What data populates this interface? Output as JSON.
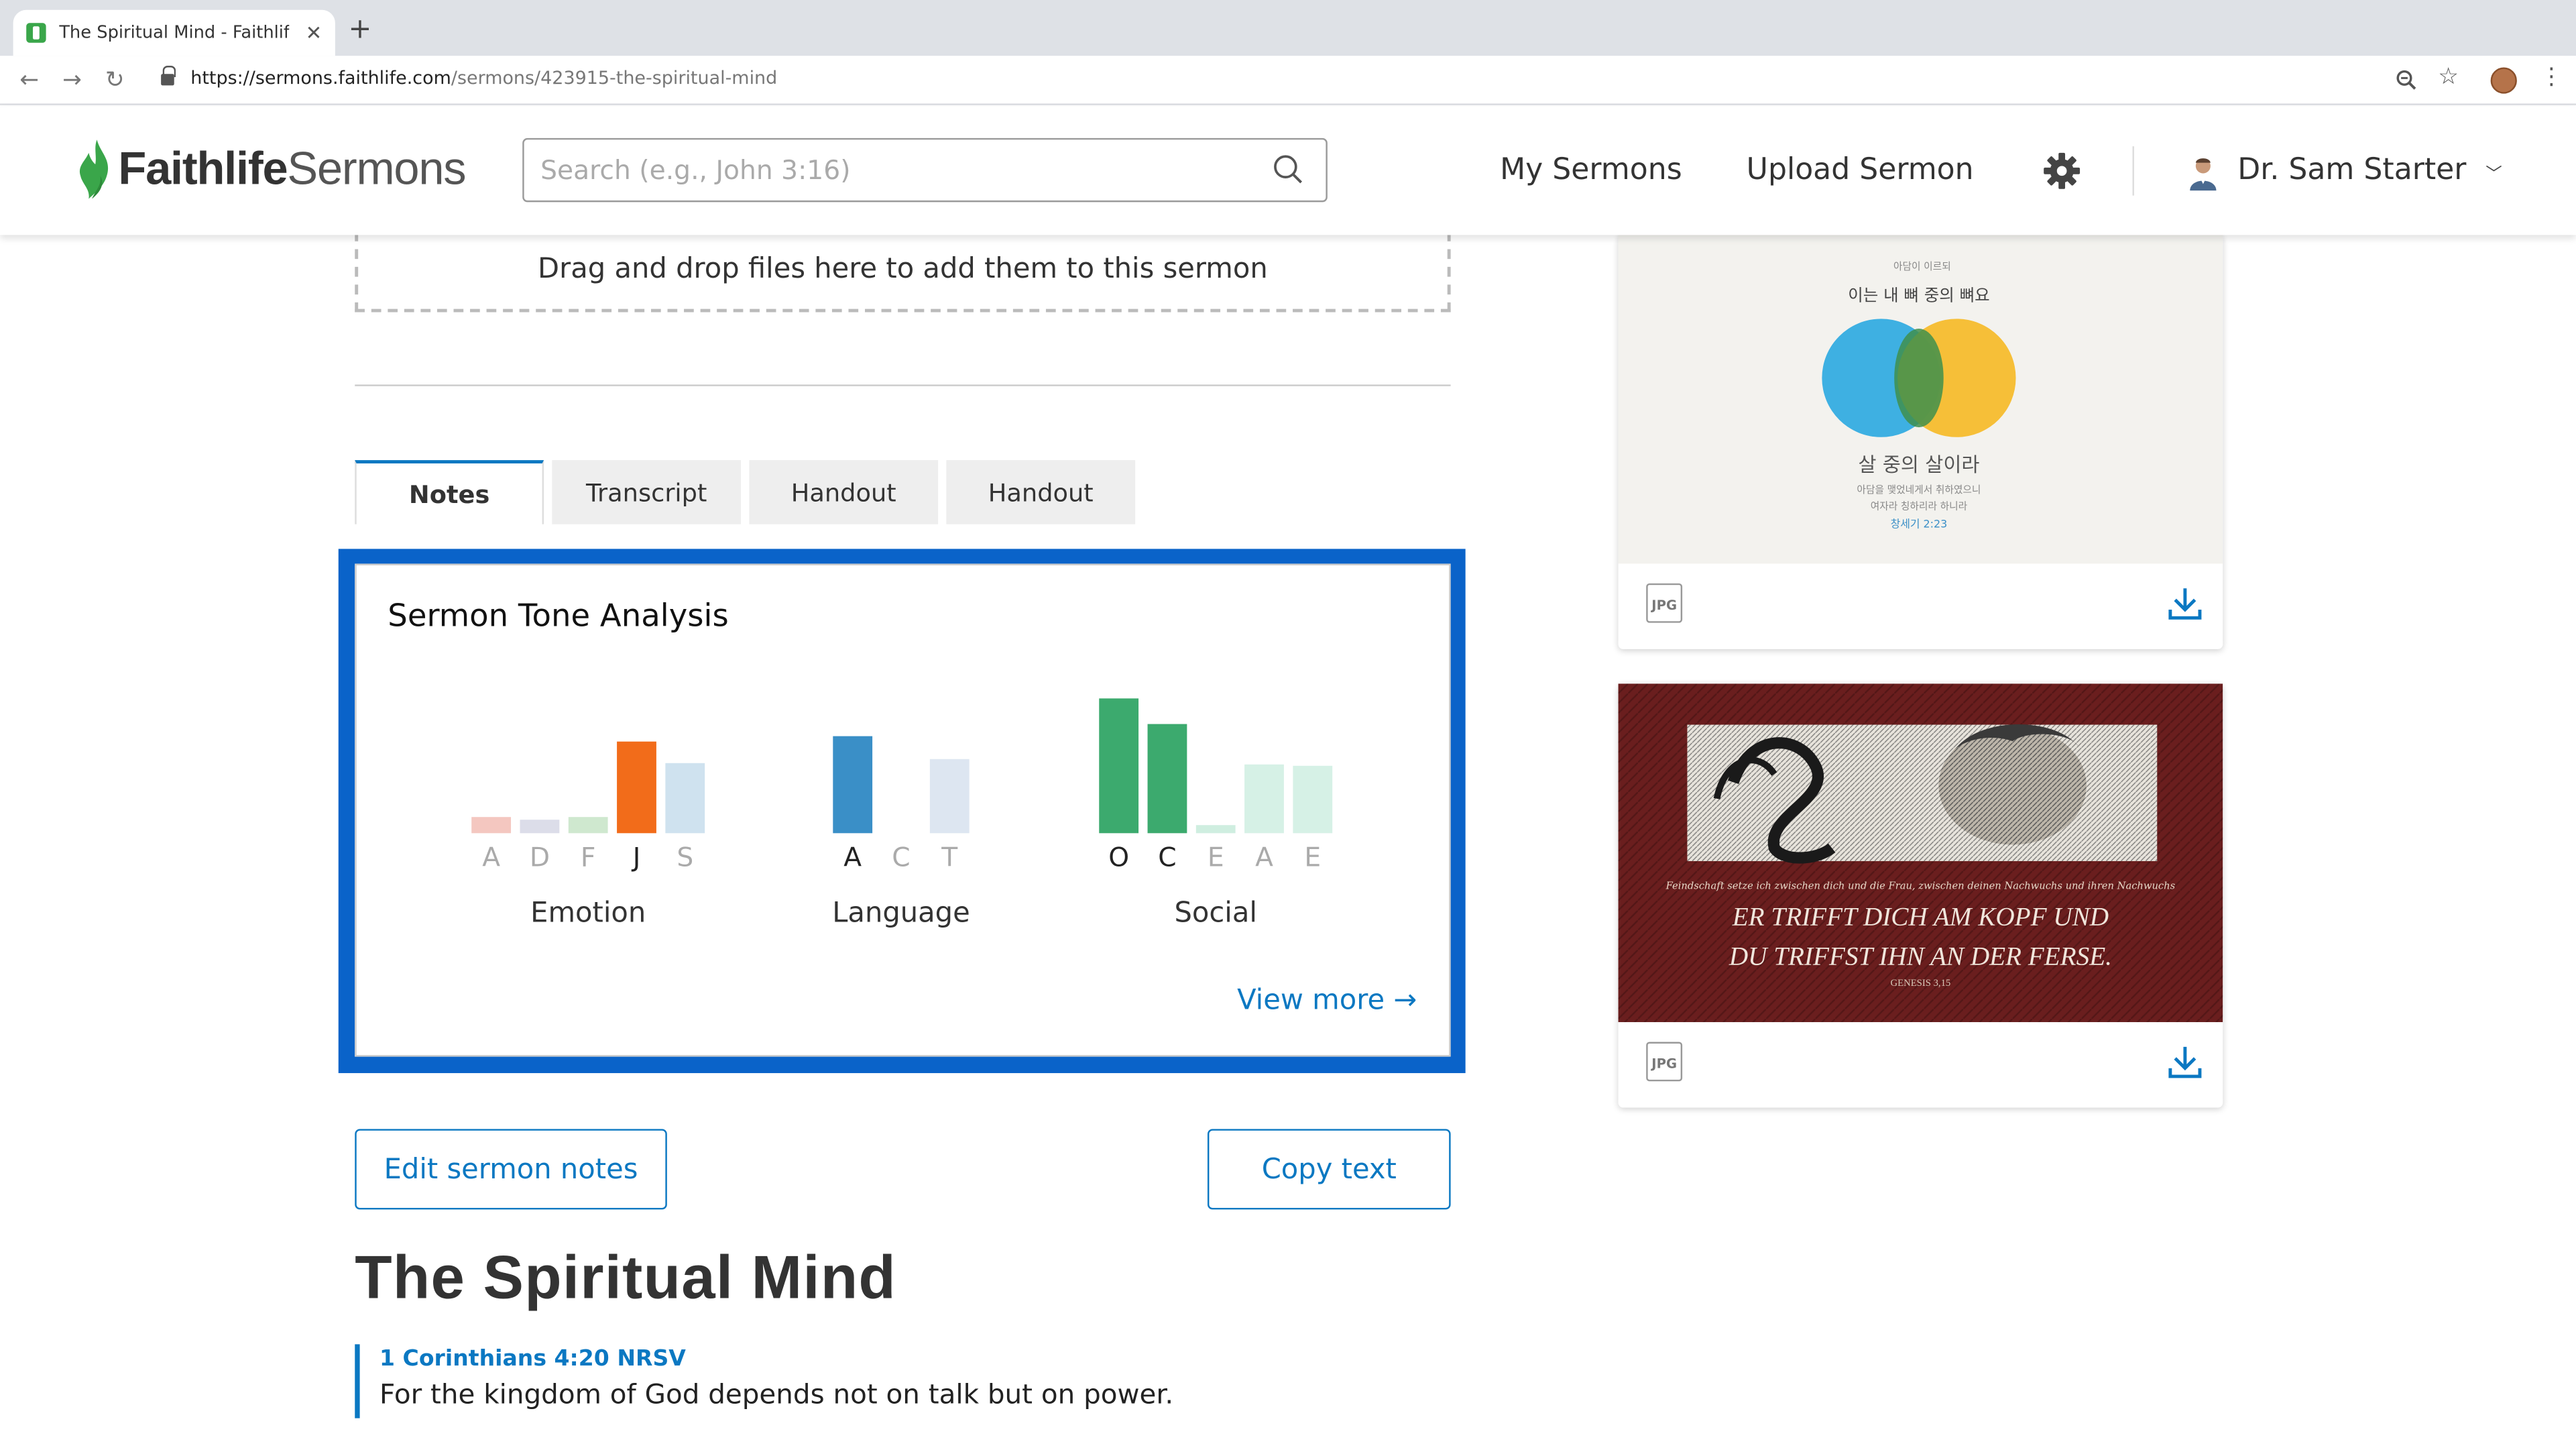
{
  "browser": {
    "tab_title": "The Spiritual Mind - Faithlife Sermons",
    "url_domain": "https://sermons.faithlife.com",
    "url_path": "/sermons/423915-the-spiritual-mind"
  },
  "header": {
    "logo_bold": "Faithlife",
    "logo_light": "Sermons",
    "search_placeholder": "Search (e.g., John 3:16)",
    "nav": [
      "My Sermons",
      "Upload Sermon"
    ],
    "user_name": "Dr. Sam Starter"
  },
  "dropzone_text": "Drag and drop files here to add them to this sermon",
  "tabs": [
    {
      "label": "Notes",
      "active": true
    },
    {
      "label": "Transcript",
      "active": false
    },
    {
      "label": "Handout",
      "active": false
    },
    {
      "label": "Handout",
      "active": false
    }
  ],
  "tone": {
    "title": "Sermon Tone Analysis",
    "view_more": "View more →"
  },
  "chart_data": {
    "type": "bar",
    "groups": [
      {
        "name": "Emotion",
        "categories": [
          "A",
          "D",
          "F",
          "J",
          "S"
        ],
        "values": [
          0.12,
          0.1,
          0.12,
          0.68,
          0.52
        ],
        "colors": [
          "#f4c7c0",
          "#dcdde9",
          "#cfe8cf",
          "#f26c1a",
          "#cfe2ef"
        ],
        "highlight": [
          false,
          false,
          false,
          true,
          false
        ]
      },
      {
        "name": "Language",
        "categories": [
          "A",
          "C",
          "T"
        ],
        "values": [
          0.72,
          0.0,
          0.55
        ],
        "colors": [
          "#3a8fc7",
          "#dde6f1",
          "#dde6f1"
        ],
        "highlight": [
          true,
          false,
          false
        ]
      },
      {
        "name": "Social",
        "categories": [
          "O",
          "C",
          "E",
          "A",
          "E"
        ],
        "values": [
          1.0,
          0.81,
          0.06,
          0.51,
          0.5
        ],
        "colors": [
          "#3caa6e",
          "#3caa6e",
          "#cfeee0",
          "#d6f1e6",
          "#d6f1e6"
        ],
        "highlight": [
          true,
          true,
          false,
          false,
          false
        ]
      }
    ],
    "ylim": [
      0,
      1
    ]
  },
  "buttons": {
    "edit_notes": "Edit sermon notes",
    "copy_text": "Copy text"
  },
  "sermon": {
    "title": "The Spiritual Mind",
    "scripture_ref": "1 Corinthians 4:20 NRSV",
    "scripture_text": "For the kingdom of God depends not on talk but on power."
  },
  "assets": [
    {
      "type": "JPG",
      "text_lines": [
        "이는 내 뼈 중의 뼈요",
        "살 중의 살이라",
        "창세기 2:23"
      ]
    },
    {
      "type": "JPG",
      "text_lines": [
        "ER TRIFFT DICH AM KOPF UND",
        "DU TRIFFST IHN AN DER FERSE.",
        "GENESIS 3,15"
      ]
    }
  ]
}
